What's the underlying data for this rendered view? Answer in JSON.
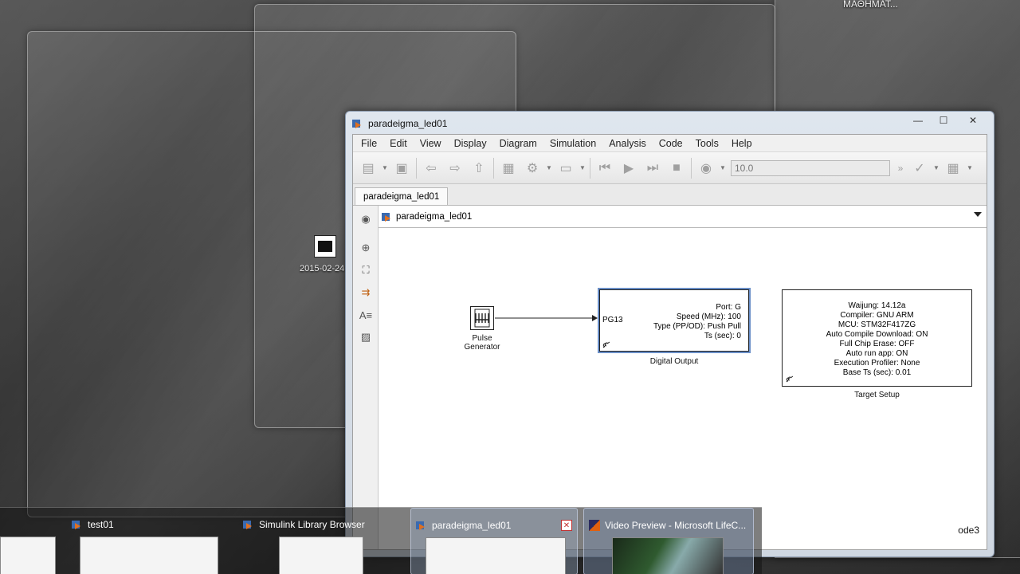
{
  "desktop": {
    "top_right_text": "ΜΑΘΗΜΑΤ...",
    "icon_label": "2015-02-24"
  },
  "window": {
    "title": "paradeigma_led01",
    "controls": {
      "minimize": "—",
      "maximize": "☐",
      "close": "✕"
    },
    "menu": [
      "File",
      "Edit",
      "View",
      "Display",
      "Diagram",
      "Simulation",
      "Analysis",
      "Code",
      "Tools",
      "Help"
    ],
    "stop_time": "10.0",
    "tab_label": "paradeigma_led01",
    "address": "paradeigma_led01",
    "solver": "ode3"
  },
  "model": {
    "pulse_generator": {
      "caption_line1": "Pulse",
      "caption_line2": "Generator"
    },
    "digital_output": {
      "port_label": "PG13",
      "lines": [
        "Port: G",
        "Speed (MHz): 100",
        "Type (PP/OD): Push Pull",
        "Ts (sec): 0"
      ],
      "caption": "Digital Output"
    },
    "target_setup": {
      "lines": [
        "Waijung: 14.12a",
        "Compiler: GNU ARM",
        "MCU: STM32F417ZG",
        "Auto Compile Download: ON",
        "Full Chip Erase: OFF",
        "Auto run app: ON",
        "Execution Profiler: None",
        "Base Ts (sec): 0.01"
      ],
      "caption": "Target Setup"
    }
  },
  "taskbar": {
    "items": [
      {
        "title": "test01"
      },
      {
        "title": "Simulink Library Browser"
      },
      {
        "title": "paradeigma_led01"
      },
      {
        "title": "Video Preview - Microsoft LifeC..."
      }
    ]
  }
}
